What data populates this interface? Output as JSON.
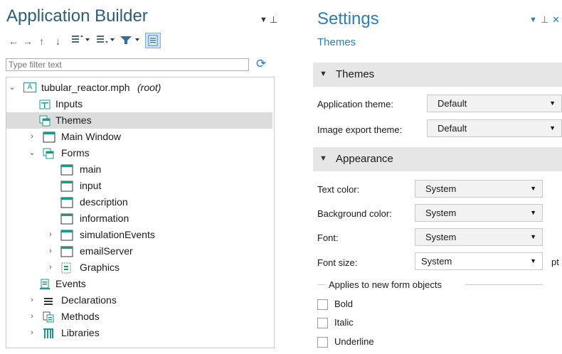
{
  "application_builder": {
    "title": "Application Builder",
    "filter_placeholder": "Type filter text",
    "tree": [
      {
        "label": "tubular_reactor.mph",
        "suffix": "(root)",
        "icon": "app-icon"
      },
      {
        "label": "Inputs",
        "icon": "inputs-icon"
      },
      {
        "label": "Themes",
        "icon": "themes-icon"
      },
      {
        "label": "Main Window",
        "icon": "window-icon"
      },
      {
        "label": "Forms",
        "icon": "forms-icon"
      },
      {
        "label": "main",
        "icon": "form-icon"
      },
      {
        "label": "input",
        "icon": "form-icon"
      },
      {
        "label": "description",
        "icon": "form-icon"
      },
      {
        "label": "information",
        "icon": "form-icon"
      },
      {
        "label": "simulationEvents",
        "icon": "form-icon"
      },
      {
        "label": "emailServer",
        "icon": "form-icon"
      },
      {
        "label": "Graphics",
        "icon": "graphics-icon"
      },
      {
        "label": "Events",
        "icon": "events-icon"
      },
      {
        "label": "Declarations",
        "icon": "declarations-icon"
      },
      {
        "label": "Methods",
        "icon": "methods-icon"
      },
      {
        "label": "Libraries",
        "icon": "libraries-icon"
      }
    ]
  },
  "settings": {
    "title": "Settings",
    "subtitle": "Themes",
    "themes_section": {
      "header": "Themes",
      "app_theme_label": "Application theme:",
      "app_theme_value": "Default",
      "image_theme_label": "Image export theme:",
      "image_theme_value": "Default"
    },
    "appearance_section": {
      "header": "Appearance",
      "text_color_label": "Text color:",
      "text_color_value": "System",
      "bg_color_label": "Background color:",
      "bg_color_value": "System",
      "font_label": "Font:",
      "font_value": "System",
      "font_size_label": "Font size:",
      "font_size_value": "System",
      "font_size_unit": "pt",
      "group_title": "Applies to new form objects",
      "bold_label": "Bold",
      "italic_label": "Italic",
      "underline_label": "Underline"
    }
  },
  "colors": {
    "accent_title": "#2a7fb8",
    "selection": "#dcdcdc",
    "section_header": "#e6e6e6",
    "icon_teal": "#1a9a8a"
  }
}
